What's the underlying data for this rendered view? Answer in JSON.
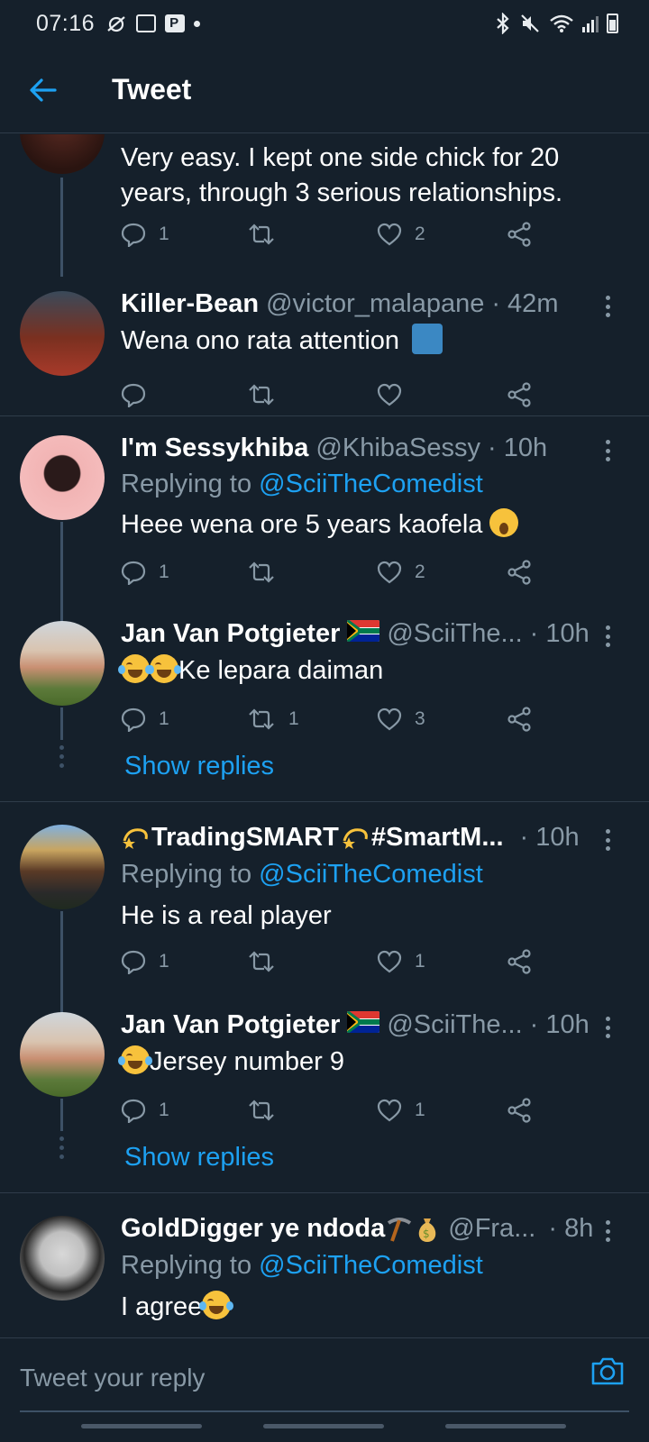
{
  "status_bar": {
    "time": "07:16"
  },
  "header": {
    "title": "Tweet"
  },
  "tweets": [
    {
      "text": "Very easy. I kept one side chick for 20 years, through 3 serious relationships.",
      "replies": "1",
      "retweets": "",
      "likes": "2"
    },
    {
      "name": "Killer-Bean",
      "handle": "@victor_malapane",
      "time": "· 42m",
      "text": "Wena ono rata attention",
      "replies": "",
      "retweets": "",
      "likes": ""
    },
    {
      "name": "I'm Sessykhiba",
      "handle": "@KhibaSessy",
      "time": "· 10h",
      "replying_label": "Replying to",
      "replying_to": "@SciiTheComedist",
      "text": "Heee wena ore 5 years kaofela",
      "replies": "1",
      "retweets": "",
      "likes": "2"
    },
    {
      "name": "Jan Van Potgieter",
      "handle": "@SciiThe...",
      "time": "· 10h",
      "text": "Ke lepara daiman",
      "replies": "1",
      "retweets": "1",
      "likes": "3"
    },
    {
      "name": "TradingSMART",
      "name2": "#SmartM...",
      "handle": "",
      "time": "· 10h",
      "replying_label": "Replying to",
      "replying_to": "@SciiTheComedist",
      "text": "He is a real player",
      "replies": "1",
      "retweets": "",
      "likes": "1"
    },
    {
      "name": "Jan Van Potgieter",
      "handle": "@SciiThe...",
      "time": "· 10h",
      "text": "Jersey number 9",
      "replies": "1",
      "retweets": "",
      "likes": "1"
    },
    {
      "name": "GoldDigger ye ndoda",
      "handle": "@Fra...",
      "time": "· 8h",
      "replying_label": "Replying to",
      "replying_to": "@SciiTheComedist",
      "text": "I agree"
    }
  ],
  "show_replies": "Show replies",
  "reply_bar": {
    "placeholder": "Tweet your reply"
  },
  "icons": {
    "reply": "reply-icon",
    "retweet": "retweet-icon",
    "like": "heart-icon",
    "share": "share-icon",
    "back": "arrow-left-icon",
    "camera": "camera-icon",
    "more": "more-vertical-icon"
  },
  "colors": {
    "background": "#15202b",
    "accent": "#1da1f2",
    "secondary_text": "#8899a6",
    "divider": "#2f3c4a"
  }
}
